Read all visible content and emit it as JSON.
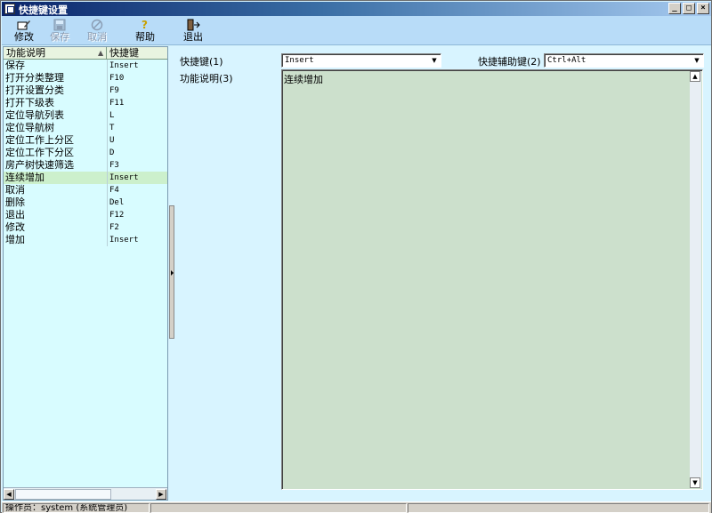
{
  "window": {
    "title": "快捷键设置",
    "controls": [
      "_",
      "□",
      "×"
    ]
  },
  "toolbar": {
    "edit_label": "修改",
    "save_label": "保存",
    "cancel_label": "取消",
    "help_label": "帮助",
    "exit_label": "退出"
  },
  "list": {
    "col1_header": "功能说明",
    "col2_header": "快捷键",
    "sort_glyph": "▲",
    "rows": [
      {
        "name": "保存",
        "key": "Insert"
      },
      {
        "name": "打开分类整理",
        "key": "F10"
      },
      {
        "name": "打开设置分类",
        "key": "F9"
      },
      {
        "name": "打开下级表",
        "key": "F11"
      },
      {
        "name": "定位导航列表",
        "key": "L"
      },
      {
        "name": "定位导航树",
        "key": "T"
      },
      {
        "name": "定位工作上分区",
        "key": "U"
      },
      {
        "name": "定位工作下分区",
        "key": "D"
      },
      {
        "name": "房产树快速筛选",
        "key": "F3"
      },
      {
        "name": "连续增加",
        "key": "Insert"
      },
      {
        "name": "取消",
        "key": "F4"
      },
      {
        "name": "删除",
        "key": "Del"
      },
      {
        "name": "退出",
        "key": "F12"
      },
      {
        "name": "修改",
        "key": "F2"
      },
      {
        "name": "增加",
        "key": "Insert"
      }
    ]
  },
  "form": {
    "shortcut_label": "快捷键(1)",
    "shortcut_value": "Insert",
    "modifier_label": "快捷辅助键(2)",
    "modifier_value": "Ctrl+Alt",
    "desc_label": "功能说明(3)",
    "desc_value": "连续增加"
  },
  "status": {
    "operator": "操作员：system (系统管理员)"
  }
}
